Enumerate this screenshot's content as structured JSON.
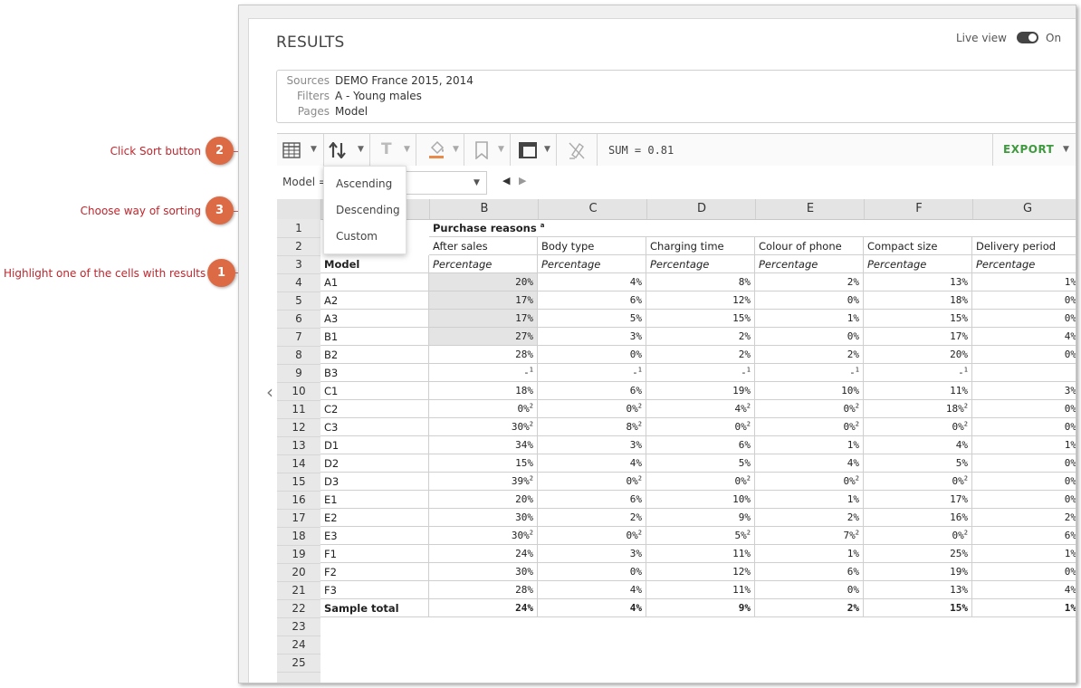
{
  "panel": {
    "title": "RESULTS",
    "live_view_label": "Live view",
    "toggle_state": "On"
  },
  "info": {
    "rows": [
      {
        "label": "Sources",
        "value": "DEMO France 2015, 2014"
      },
      {
        "label": "Filters",
        "value": "A - Young males"
      },
      {
        "label": "Pages",
        "value": "Model"
      }
    ]
  },
  "toolbar": {
    "sum_text": "SUM = 0.81",
    "export_label": "EXPORT",
    "accent": "#3f9a3f",
    "highlight_color": "#e88a4a"
  },
  "filter": {
    "label": "Model ="
  },
  "sort_menu": {
    "items": [
      "Ascending",
      "Descending",
      "Custom"
    ]
  },
  "grid": {
    "columns": [
      "B",
      "C",
      "D",
      "E",
      "F",
      "G"
    ],
    "row_numbers": [
      "1",
      "2",
      "3",
      "4",
      "5",
      "6",
      "7",
      "8",
      "9",
      "10",
      "11",
      "12",
      "13",
      "14",
      "15",
      "16",
      "17",
      "18",
      "19",
      "20",
      "21",
      "22",
      "23",
      "24",
      "25"
    ],
    "header_title": "Purchase reasons",
    "header_footnote": "a",
    "subheaders": [
      "After sales",
      "Body type",
      "Charging time",
      "Colour of phone",
      "Compact size",
      "Delivery period"
    ],
    "row3_label": "Model",
    "unit_label": "Percentage",
    "rows": [
      {
        "label": "A1",
        "values": [
          "20%",
          "4%",
          "8%",
          "2%",
          "13%",
          "1%"
        ]
      },
      {
        "label": "A2",
        "values": [
          "17%",
          "6%",
          "12%",
          "0%",
          "18%",
          "0%"
        ]
      },
      {
        "label": "A3",
        "values": [
          "17%",
          "5%",
          "15%",
          "1%",
          "15%",
          "0%"
        ]
      },
      {
        "label": "B1",
        "values": [
          "27%",
          "3%",
          "2%",
          "0%",
          "17%",
          "4%"
        ]
      },
      {
        "label": "B2",
        "values": [
          "28%",
          "0%",
          "2%",
          "2%",
          "20%",
          "0%"
        ]
      },
      {
        "label": "B3",
        "values": [
          "- ¹",
          "- ¹",
          "- ¹",
          "- ¹",
          "- ¹",
          ""
        ]
      },
      {
        "label": "C1",
        "values": [
          "18%",
          "6%",
          "19%",
          "10%",
          "11%",
          "3%"
        ]
      },
      {
        "label": "C2",
        "values": [
          "0% ²",
          "0% ²",
          "4% ²",
          "0% ²",
          "18% ²",
          "0%"
        ]
      },
      {
        "label": "C3",
        "values": [
          "30% ²",
          "8% ²",
          "0% ²",
          "0% ²",
          "0% ²",
          "0%"
        ]
      },
      {
        "label": "D1",
        "values": [
          "34%",
          "3%",
          "6%",
          "1%",
          "4%",
          "1%"
        ]
      },
      {
        "label": "D2",
        "values": [
          "15%",
          "4%",
          "5%",
          "4%",
          "5%",
          "0%"
        ]
      },
      {
        "label": "D3",
        "values": [
          "39% ²",
          "0% ²",
          "0% ²",
          "0% ²",
          "0% ²",
          "0%"
        ]
      },
      {
        "label": "E1",
        "values": [
          "20%",
          "6%",
          "10%",
          "1%",
          "17%",
          "0%"
        ]
      },
      {
        "label": "E2",
        "values": [
          "30%",
          "2%",
          "9%",
          "2%",
          "16%",
          "2%"
        ]
      },
      {
        "label": "E3",
        "values": [
          "30% ²",
          "0% ²",
          "5% ²",
          "7% ²",
          "0% ²",
          "6%"
        ]
      },
      {
        "label": "F1",
        "values": [
          "24%",
          "3%",
          "11%",
          "1%",
          "25%",
          "1%"
        ]
      },
      {
        "label": "F2",
        "values": [
          "30%",
          "0%",
          "12%",
          "6%",
          "19%",
          "0%"
        ]
      },
      {
        "label": "F3",
        "values": [
          "28%",
          "4%",
          "11%",
          "0%",
          "13%",
          "4%"
        ]
      }
    ],
    "total": {
      "label": "Sample total",
      "values": [
        "24%",
        "4%",
        "9%",
        "2%",
        "15%",
        "1%"
      ]
    }
  },
  "annotations": [
    {
      "number": "2",
      "text": "Click Sort button"
    },
    {
      "number": "3",
      "text": "Choose way of sorting"
    },
    {
      "number": "1",
      "text": "Highlight one of the cells with results"
    }
  ]
}
